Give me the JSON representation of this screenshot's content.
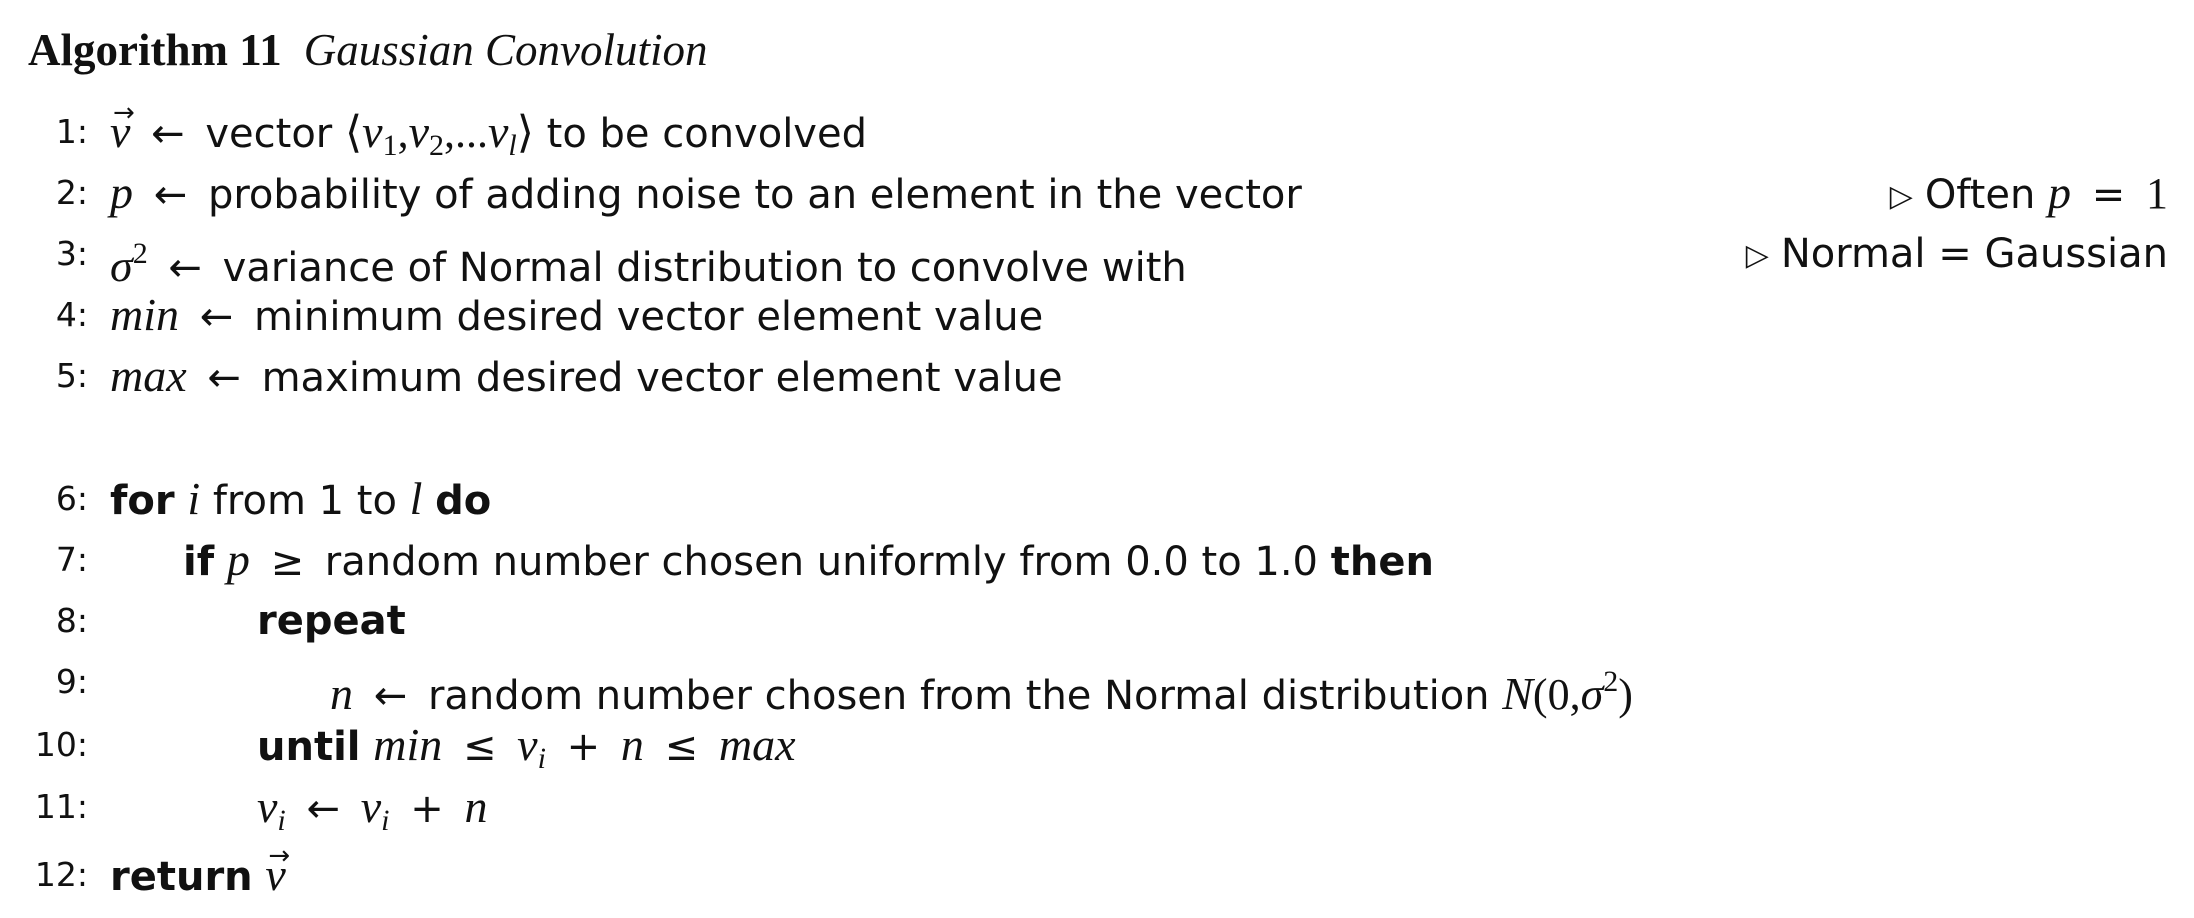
{
  "caption": {
    "label": "Algorithm 11",
    "title": "Gaussian Convolution"
  },
  "lines": [
    {
      "num": "1:",
      "var": "v",
      "text": "vector",
      "seq_open": "⟨",
      "v1": "v",
      "s1": "1",
      "comma1": ",",
      "v2": "v",
      "s2": "2",
      "comma2": ",",
      "dots": "...",
      "vl": "v",
      "sl": "l",
      "seq_close": "⟩",
      "tail": "to be convolved"
    },
    {
      "num": "2:",
      "var": "p",
      "text": "probability of adding noise to an element in the vector",
      "comment_prefix": "Often",
      "comment_var": "p",
      "comment_op": "=",
      "comment_val": "1"
    },
    {
      "num": "3:",
      "var": "σ",
      "sup": "2",
      "text": "variance of Normal distribution to convolve with",
      "comment_text": "Normal = Gaussian"
    },
    {
      "num": "4:",
      "var": "min",
      "text": "minimum desired vector element value"
    },
    {
      "num": "5:",
      "var": "max",
      "text": "maximum desired vector element value"
    },
    {
      "num": "6:",
      "kw_for": "for",
      "var": "i",
      "from": "from 1 to",
      "limit": "l",
      "kw_do": "do"
    },
    {
      "num": "7:",
      "kw_if": "if",
      "var": "p",
      "op": "≥",
      "text": "random number chosen uniformly from 0.0 to 1.0",
      "kw_then": "then"
    },
    {
      "num": "8:",
      "kw": "repeat"
    },
    {
      "num": "9:",
      "var": "n",
      "text": "random number chosen from the Normal distribution",
      "fn": "N",
      "fn_open": "(0,",
      "fn_sigma": "σ",
      "fn_sup": "2",
      "fn_close": ")"
    },
    {
      "num": "10:",
      "kw": "until",
      "min": "min",
      "le1": "≤",
      "v": "v",
      "sub": "i",
      "plus": "+",
      "n": "n",
      "le2": "≤",
      "max": "max"
    },
    {
      "num": "11:",
      "v": "v",
      "sub": "i",
      "v2": "v",
      "sub2": "i",
      "plus": "+",
      "n": "n"
    },
    {
      "num": "12:",
      "kw": "return",
      "var": "v"
    }
  ],
  "symbols": {
    "assign": "←",
    "vec_arrow": "→",
    "comment_marker": "▷"
  }
}
